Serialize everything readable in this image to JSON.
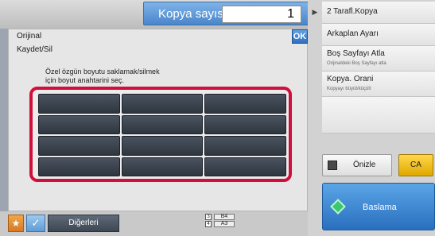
{
  "header": {
    "copy_count_label": "Kopya sayısı",
    "copy_count_value": "1"
  },
  "dialog": {
    "title_line1": "Orijinal",
    "title_line2": "Kaydet/Sil",
    "ok_label": "OK",
    "message_line1": "Özel özgün boyutu saklamak/silmek",
    "message_line2": "için boyut anahtarini seç."
  },
  "size_keys": [
    "",
    "",
    "",
    "",
    "",
    "",
    "",
    "",
    "",
    "",
    "",
    ""
  ],
  "right_panel": {
    "items": [
      {
        "label": "2 Tarafl.Kopya"
      },
      {
        "label": "Arkaplan Ayarı"
      },
      {
        "label": "Boş Sayfayı Atla",
        "sub": "Orijinaldeki Boş Sayfayı atla"
      },
      {
        "label": "Kopya. Orani",
        "sub": "Kopyayı büyüt/küçült"
      }
    ],
    "preview_label": "Önizle",
    "ca_label": "CA",
    "start_label": "Baslama"
  },
  "bottom": {
    "others_label": "Diğerleri",
    "paper": [
      {
        "tray": "3",
        "size": "B4"
      },
      {
        "tray": "4",
        "size": "A3"
      }
    ]
  },
  "colors": {
    "accent": "#d0103a",
    "start": "#2a6fbf",
    "ca": "#e0a800"
  }
}
